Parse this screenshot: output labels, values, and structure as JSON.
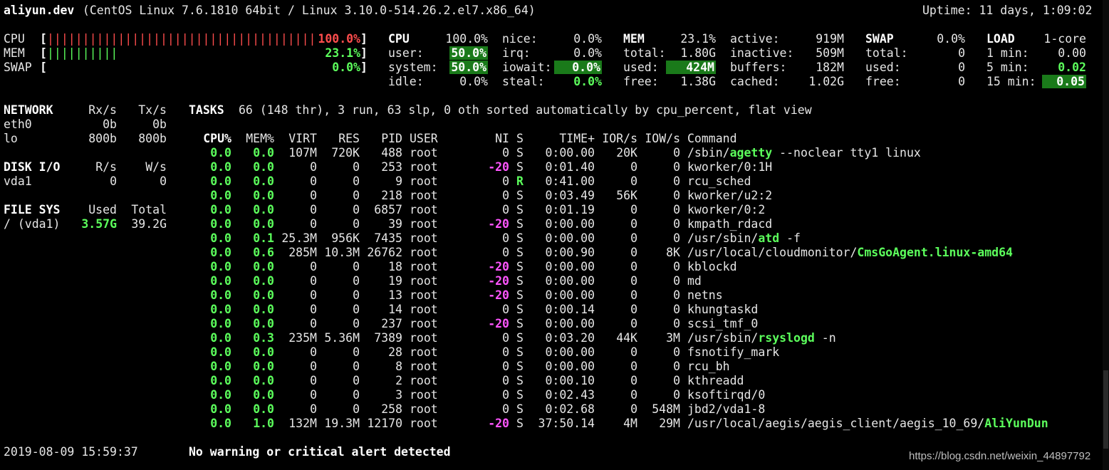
{
  "header": {
    "hostname": "aliyun.dev",
    "system": " (CentOS Linux 7.6.1810 64bit / Linux 3.10.0-514.26.2.el7.x86_64)",
    "uptime": "Uptime: 11 days, 1:09:02"
  },
  "quicklook": {
    "cpu_label": "CPU",
    "cpu_bar": "|||||||||||||||||||||||||||||||||||||||||",
    "cpu_value": "100.0%",
    "mem_label": "MEM",
    "mem_bar": "||||||||||",
    "mem_value": "23.1%",
    "swap_label": "SWAP",
    "swap_value": "0.0%",
    "open_bracket": "[",
    "close_bracket": "]"
  },
  "cpu": {
    "title": "CPU",
    "total": "100.0%",
    "user_label": "user:",
    "user": "50.0%",
    "system_label": "system:",
    "system": "50.0%",
    "idle_label": "idle:",
    "idle": "0.0%",
    "nice_label": "nice:",
    "nice": "0.0%",
    "irq_label": "irq:",
    "irq": "0.0%",
    "iowait_label": "iowait:",
    "iowait": "0.0%",
    "steal_label": "steal:",
    "steal": "0.0%"
  },
  "mem": {
    "title": "MEM",
    "percent": "23.1%",
    "total_label": "total:",
    "total": "1.80G",
    "used_label": "used:",
    "used": "424M",
    "free_label": "free:",
    "free": "1.38G",
    "active_label": "active:",
    "active": "919M",
    "inactive_label": "inactive:",
    "inactive": "509M",
    "buffers_label": "buffers:",
    "buffers": "182M",
    "cached_label": "cached:",
    "cached": "1.02G"
  },
  "swap": {
    "title": "SWAP",
    "percent": "0.0%",
    "total_label": "total:",
    "total": "0",
    "used_label": "used:",
    "used": "0",
    "free_label": "free:",
    "free": "0"
  },
  "load": {
    "title": "LOAD",
    "cores": "1-core",
    "min1_label": "1 min:",
    "min1": "0.00",
    "min5_label": "5 min:",
    "min5": "0.02",
    "min15_label": "15 min:",
    "min15": "0.05"
  },
  "network": {
    "title": "NETWORK",
    "rx_header": "Rx/s",
    "tx_header": "Tx/s",
    "rows": [
      {
        "name": "eth0",
        "rx": "0b",
        "tx": "0b"
      },
      {
        "name": "lo",
        "rx": "800b",
        "tx": "800b"
      }
    ]
  },
  "disk": {
    "title": "DISK I/O",
    "r_header": "R/s",
    "w_header": "W/s",
    "rows": [
      {
        "name": "vda1",
        "r": "0",
        "w": "0"
      }
    ]
  },
  "filesys": {
    "title": "FILE SYS",
    "used_header": "Used",
    "total_header": "Total",
    "rows": [
      {
        "name": "/ (vda1)",
        "used": "3.57G",
        "total": "39.2G"
      }
    ]
  },
  "tasks": {
    "title": "TASKS",
    "summary": "66 (148 thr), 3 run, 63 slp, 0 oth sorted automatically by cpu_percent, flat view"
  },
  "process_table": {
    "headers": {
      "cpu": "CPU%",
      "mem": "MEM%",
      "virt": "VIRT",
      "res": "RES",
      "pid": "PID",
      "user": "USER",
      "ni": "NI",
      "s": "S",
      "time": "TIME+",
      "ior": "IOR/s",
      "iow": "IOW/s",
      "cmd": "Command"
    },
    "rows": [
      {
        "cpu": "0.0",
        "mem": "0.0",
        "virt": "107M",
        "res": "720K",
        "pid": "488",
        "user": "root",
        "ni": "0",
        "s": "S",
        "time": "0:00.00",
        "ior": "20K",
        "iow": "0",
        "cmd_pre": "/sbin/",
        "cmd_hl": "agetty",
        "cmd_post": " --noclear tty1 linux"
      },
      {
        "cpu": "0.0",
        "mem": "0.0",
        "virt": "0",
        "res": "0",
        "pid": "253",
        "user": "root",
        "ni": "-20",
        "s": "S",
        "time": "0:01.40",
        "ior": "0",
        "iow": "0",
        "cmd_pre": "kworker/0:1H",
        "cmd_hl": "",
        "cmd_post": ""
      },
      {
        "cpu": "0.0",
        "mem": "0.0",
        "virt": "0",
        "res": "0",
        "pid": "9",
        "user": "root",
        "ni": "0",
        "s": "R",
        "time": "0:41.00",
        "ior": "0",
        "iow": "0",
        "cmd_pre": "rcu_sched",
        "cmd_hl": "",
        "cmd_post": ""
      },
      {
        "cpu": "0.0",
        "mem": "0.0",
        "virt": "0",
        "res": "0",
        "pid": "218",
        "user": "root",
        "ni": "0",
        "s": "S",
        "time": "0:03.49",
        "ior": "56K",
        "iow": "0",
        "cmd_pre": "kworker/u2:2",
        "cmd_hl": "",
        "cmd_post": ""
      },
      {
        "cpu": "0.0",
        "mem": "0.0",
        "virt": "0",
        "res": "0",
        "pid": "6857",
        "user": "root",
        "ni": "0",
        "s": "S",
        "time": "0:01.19",
        "ior": "0",
        "iow": "0",
        "cmd_pre": "kworker/0:2",
        "cmd_hl": "",
        "cmd_post": ""
      },
      {
        "cpu": "0.0",
        "mem": "0.0",
        "virt": "0",
        "res": "0",
        "pid": "39",
        "user": "root",
        "ni": "-20",
        "s": "S",
        "time": "0:00.00",
        "ior": "0",
        "iow": "0",
        "cmd_pre": "kmpath_rdacd",
        "cmd_hl": "",
        "cmd_post": ""
      },
      {
        "cpu": "0.0",
        "mem": "0.1",
        "virt": "25.3M",
        "res": "956K",
        "pid": "7435",
        "user": "root",
        "ni": "0",
        "s": "S",
        "time": "0:00.00",
        "ior": "0",
        "iow": "0",
        "cmd_pre": "/usr/sbin/",
        "cmd_hl": "atd",
        "cmd_post": " -f"
      },
      {
        "cpu": "0.0",
        "mem": "0.6",
        "virt": "285M",
        "res": "10.3M",
        "pid": "26762",
        "user": "root",
        "ni": "0",
        "s": "S",
        "time": "0:00.90",
        "ior": "0",
        "iow": "8K",
        "cmd_pre": "/usr/local/cloudmonitor/",
        "cmd_hl": "CmsGoAgent.linux-amd64",
        "cmd_post": ""
      },
      {
        "cpu": "0.0",
        "mem": "0.0",
        "virt": "0",
        "res": "0",
        "pid": "18",
        "user": "root",
        "ni": "-20",
        "s": "S",
        "time": "0:00.00",
        "ior": "0",
        "iow": "0",
        "cmd_pre": "kblockd",
        "cmd_hl": "",
        "cmd_post": ""
      },
      {
        "cpu": "0.0",
        "mem": "0.0",
        "virt": "0",
        "res": "0",
        "pid": "19",
        "user": "root",
        "ni": "-20",
        "s": "S",
        "time": "0:00.00",
        "ior": "0",
        "iow": "0",
        "cmd_pre": "md",
        "cmd_hl": "",
        "cmd_post": ""
      },
      {
        "cpu": "0.0",
        "mem": "0.0",
        "virt": "0",
        "res": "0",
        "pid": "13",
        "user": "root",
        "ni": "-20",
        "s": "S",
        "time": "0:00.00",
        "ior": "0",
        "iow": "0",
        "cmd_pre": "netns",
        "cmd_hl": "",
        "cmd_post": ""
      },
      {
        "cpu": "0.0",
        "mem": "0.0",
        "virt": "0",
        "res": "0",
        "pid": "14",
        "user": "root",
        "ni": "0",
        "s": "S",
        "time": "0:00.14",
        "ior": "0",
        "iow": "0",
        "cmd_pre": "khungtaskd",
        "cmd_hl": "",
        "cmd_post": ""
      },
      {
        "cpu": "0.0",
        "mem": "0.0",
        "virt": "0",
        "res": "0",
        "pid": "237",
        "user": "root",
        "ni": "-20",
        "s": "S",
        "time": "0:00.00",
        "ior": "0",
        "iow": "0",
        "cmd_pre": "scsi_tmf_0",
        "cmd_hl": "",
        "cmd_post": ""
      },
      {
        "cpu": "0.0",
        "mem": "0.3",
        "virt": "235M",
        "res": "5.36M",
        "pid": "7389",
        "user": "root",
        "ni": "0",
        "s": "S",
        "time": "0:03.20",
        "ior": "44K",
        "iow": "3M",
        "cmd_pre": "/usr/sbin/",
        "cmd_hl": "rsyslogd",
        "cmd_post": " -n"
      },
      {
        "cpu": "0.0",
        "mem": "0.0",
        "virt": "0",
        "res": "0",
        "pid": "28",
        "user": "root",
        "ni": "0",
        "s": "S",
        "time": "0:00.00",
        "ior": "0",
        "iow": "0",
        "cmd_pre": "fsnotify_mark",
        "cmd_hl": "",
        "cmd_post": ""
      },
      {
        "cpu": "0.0",
        "mem": "0.0",
        "virt": "0",
        "res": "0",
        "pid": "8",
        "user": "root",
        "ni": "0",
        "s": "S",
        "time": "0:00.00",
        "ior": "0",
        "iow": "0",
        "cmd_pre": "rcu_bh",
        "cmd_hl": "",
        "cmd_post": ""
      },
      {
        "cpu": "0.0",
        "mem": "0.0",
        "virt": "0",
        "res": "0",
        "pid": "2",
        "user": "root",
        "ni": "0",
        "s": "S",
        "time": "0:00.10",
        "ior": "0",
        "iow": "0",
        "cmd_pre": "kthreadd",
        "cmd_hl": "",
        "cmd_post": ""
      },
      {
        "cpu": "0.0",
        "mem": "0.0",
        "virt": "0",
        "res": "0",
        "pid": "3",
        "user": "root",
        "ni": "0",
        "s": "S",
        "time": "0:02.43",
        "ior": "0",
        "iow": "0",
        "cmd_pre": "ksoftirqd/0",
        "cmd_hl": "",
        "cmd_post": ""
      },
      {
        "cpu": "0.0",
        "mem": "0.0",
        "virt": "0",
        "res": "0",
        "pid": "258",
        "user": "root",
        "ni": "0",
        "s": "S",
        "time": "0:02.68",
        "ior": "0",
        "iow": "548M",
        "cmd_pre": "jbd2/vda1-8",
        "cmd_hl": "",
        "cmd_post": ""
      },
      {
        "cpu": "0.0",
        "mem": "1.0",
        "virt": "132M",
        "res": "19.3M",
        "pid": "12170",
        "user": "root",
        "ni": "-20",
        "s": "S",
        "time": "37:50.14",
        "ior": "4M",
        "iow": "29M",
        "cmd_pre": "/usr/local/aegis/aegis_client/aegis_10_69/",
        "cmd_hl": "AliYunDun",
        "cmd_post": ""
      }
    ]
  },
  "footer": {
    "datetime": "2019-08-09 15:59:37",
    "alert": "No warning or critical alert detected"
  },
  "watermark": "https://blog.csdn.net/weixin_44897792",
  "colors": {
    "background": "#000000",
    "text": "#e6e6e6",
    "ok_green": "#5cff5c",
    "highlight_green": "#1a7a1a",
    "critical_red": "#ff4d4d",
    "nice_magenta": "#ff55ff"
  }
}
